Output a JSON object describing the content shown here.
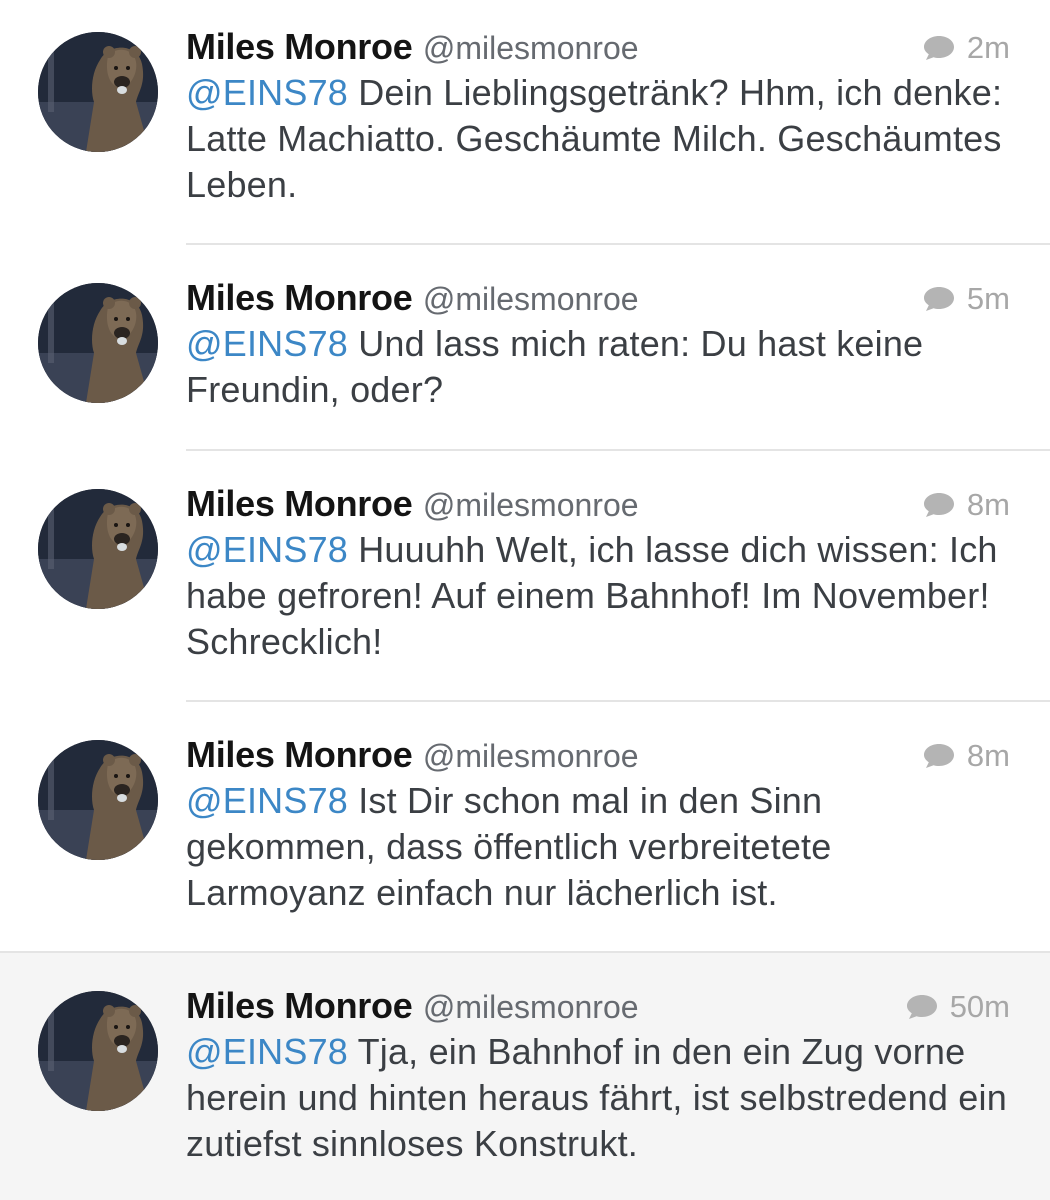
{
  "tweets": [
    {
      "name": "Miles Monroe",
      "handle": "@milesmonroe",
      "time": "2m",
      "mention": "@EINS78",
      "text": " Dein Lieblingsgetränk? Hhm, ich denke: Latte Machiatto. Geschäumte Milch. Geschäumtes Leben."
    },
    {
      "name": "Miles Monroe",
      "handle": "@milesmonroe",
      "time": "5m",
      "mention": "@EINS78",
      "text": " Und lass mich raten: Du hast keine Freundin, oder?"
    },
    {
      "name": "Miles Monroe",
      "handle": "@milesmonroe",
      "time": "8m",
      "mention": "@EINS78",
      "text": " Huuuhh Welt, ich lasse dich wissen: Ich habe gefroren! Auf einem Bahnhof! Im November! Schrecklich!"
    },
    {
      "name": "Miles Monroe",
      "handle": "@milesmonroe",
      "time": "8m",
      "mention": "@EINS78",
      "text": " Ist Dir schon mal in den Sinn gekommen, dass öffentlich verbreitetete Larmoyanz einfach nur lächerlich ist."
    },
    {
      "name": "Miles Monroe",
      "handle": "@milesmonroe",
      "time": "50m",
      "mention": "@EINS78",
      "text": " Tja, ein Bahnhof in den ein Zug vorne herein und hinten heraus fährt, ist selbstredend ein zutiefst sinnloses Konstrukt."
    }
  ],
  "icons": {
    "avatar": "bear-avatar-icon",
    "reply": "speech-bubble-icon"
  },
  "colors": {
    "mention": "#3c87c6",
    "timestamp": "#a7a7a7",
    "highlight_background": "#f5f5f5"
  }
}
